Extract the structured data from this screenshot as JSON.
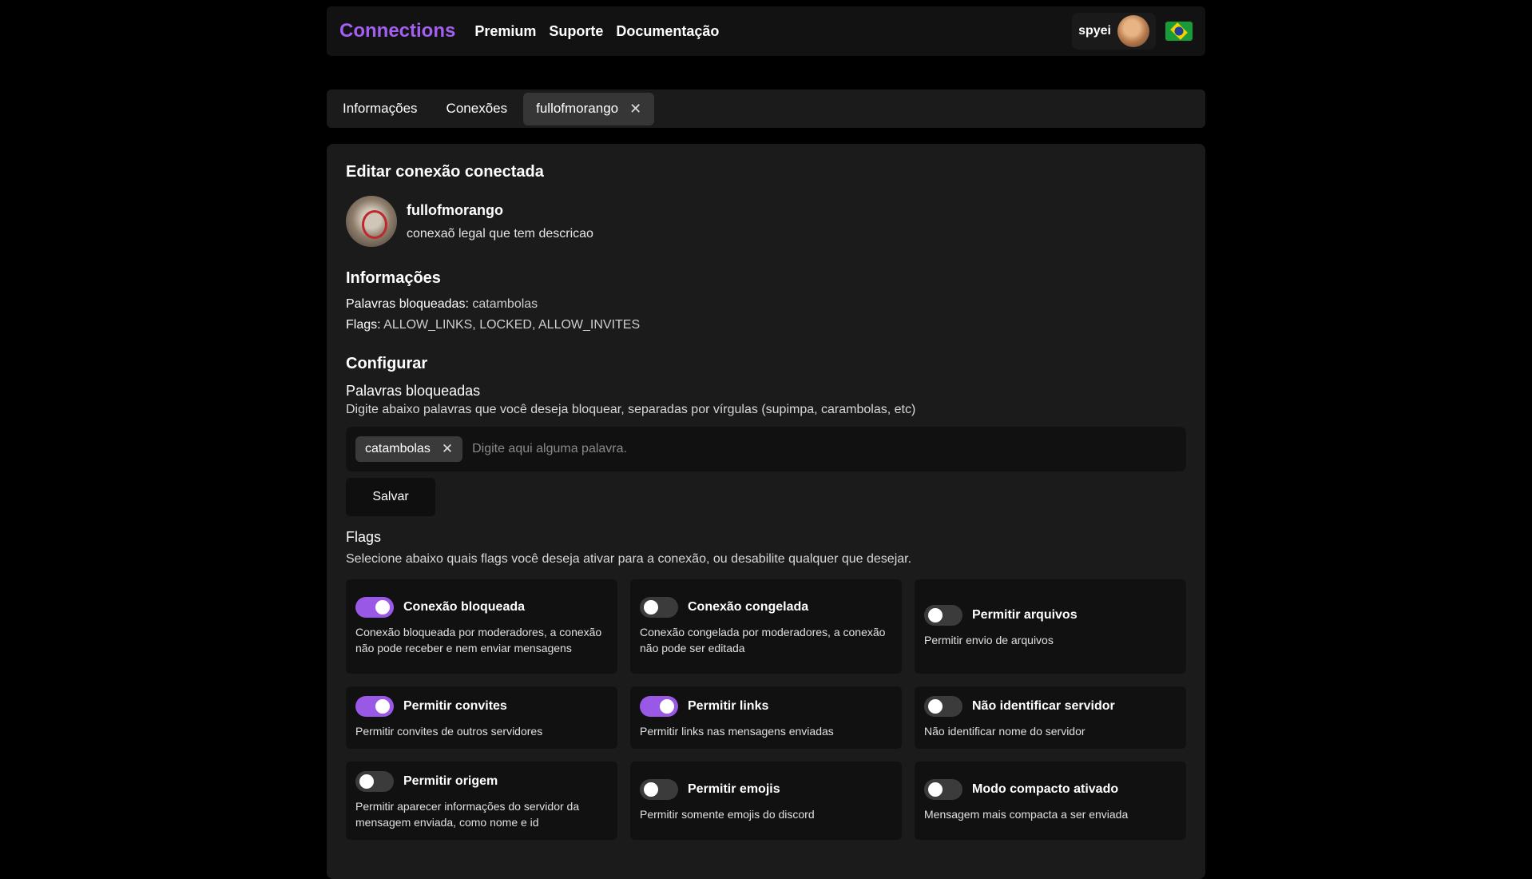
{
  "navbar": {
    "brand": "Connections",
    "links": [
      "Premium",
      "Suporte",
      "Documentação"
    ],
    "username": "spyei",
    "avatar_icon": "user-avatar",
    "language_icon": "brazil-flag-icon"
  },
  "tabs": [
    {
      "label": "Informações",
      "active": false
    },
    {
      "label": "Conexões",
      "active": false
    },
    {
      "label": "fullofmorango",
      "active": true,
      "closable": true
    }
  ],
  "panel": {
    "title": "Editar conexão conectada",
    "connection": {
      "name": "fullofmorango",
      "description": "conexaõ legal que tem descricao"
    },
    "info": {
      "title": "Informações",
      "blocked_words_label": "Palavras bloqueadas:",
      "blocked_words_value": "catambolas",
      "flags_label": "Flags:",
      "flags_value": "ALLOW_LINKS, LOCKED, ALLOW_INVITES"
    },
    "configure": {
      "title": "Configurar",
      "blocked_words_title": "Palavras bloqueadas",
      "blocked_words_desc": "Digite abaixo palavras que você deseja bloquear, separadas por vírgulas (supimpa, carambolas, etc)",
      "chips": [
        "catambolas"
      ],
      "input_placeholder": "Digite aqui alguma palavra.",
      "save_label": "Salvar",
      "flags_title": "Flags",
      "flags_desc": "Selecione abaixo quais flags você deseja ativar para a conexão, ou desabilite qualquer que desejar."
    },
    "flags": [
      {
        "label": "Conexão bloqueada",
        "desc": "Conexão bloqueada por moderadores, a conexão não pode receber e nem enviar mensagens",
        "on": true
      },
      {
        "label": "Conexão congelada",
        "desc": "Conexão congelada por moderadores, a conexão não pode ser editada",
        "on": false
      },
      {
        "label": "Permitir arquivos",
        "desc": "Permitir envio de arquivos",
        "on": false
      },
      {
        "label": "Permitir convites",
        "desc": "Permitir convites de outros servidores",
        "on": true
      },
      {
        "label": "Permitir links",
        "desc": "Permitir links nas mensagens enviadas",
        "on": true
      },
      {
        "label": "Não identificar servidor",
        "desc": "Não identificar nome do servidor",
        "on": false
      },
      {
        "label": "Permitir origem",
        "desc": "Permitir aparecer informações do servidor da mensagem enviada, como nome e id",
        "on": false
      },
      {
        "label": "Permitir emojis",
        "desc": "Permitir somente emojis do discord",
        "on": false
      },
      {
        "label": "Modo compacto ativado",
        "desc": "Mensagem mais compacta a ser enviada",
        "on": false
      }
    ],
    "accent_color": "#9a58e6"
  }
}
